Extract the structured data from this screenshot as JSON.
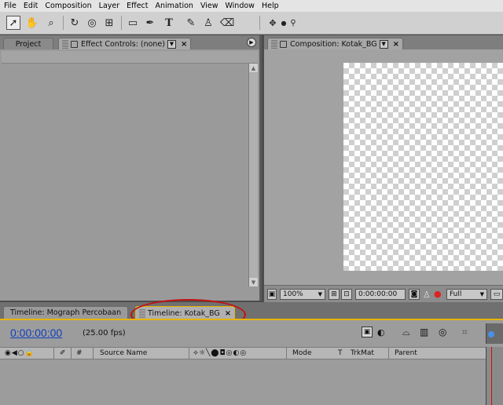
{
  "menu": [
    "File",
    "Edit",
    "Composition",
    "Layer",
    "Effect",
    "Animation",
    "View",
    "Window",
    "Help"
  ],
  "toolbar": {
    "tools": [
      {
        "name": "selection-tool-icon",
        "glyph": "➚"
      },
      {
        "name": "hand-tool-icon",
        "glyph": "✋"
      },
      {
        "name": "zoom-tool-icon",
        "glyph": "⌕"
      },
      {
        "name": "rotate-tool-icon",
        "glyph": "↻"
      },
      {
        "name": "orbit-camera-tool-icon",
        "glyph": "◎"
      },
      {
        "name": "pan-behind-tool-icon",
        "glyph": "⊞"
      },
      {
        "name": "rectangle-mask-tool-icon",
        "glyph": "▭"
      },
      {
        "name": "pen-tool-icon",
        "glyph": "✒"
      },
      {
        "name": "type-tool-icon",
        "glyph": "T"
      },
      {
        "name": "brush-tool-icon",
        "glyph": "✎"
      },
      {
        "name": "clone-stamp-tool-icon",
        "glyph": "♙"
      },
      {
        "name": "eraser-tool-icon",
        "glyph": "⌫"
      }
    ],
    "workspace_icons": [
      "✥",
      "●",
      "⚲"
    ]
  },
  "project_panel": {
    "tab_project": "Project",
    "tab_effect_controls": "Effect Controls: (none)"
  },
  "composition_panel": {
    "tab": "Composition: Kotak_BG",
    "footer": {
      "zoom": "100%",
      "timecode": "0:00:00:00",
      "resolution": "Full"
    }
  },
  "timeline": {
    "tab_inactive": "Timeline: Mograph Percobaan",
    "tab_active": "Timeline: Kotak_BG",
    "timecode": "0:00:00:00",
    "fps": "(25.00 fps)",
    "columns": {
      "hash": "#",
      "source_name": "Source Name",
      "mode": "Mode",
      "t": "T",
      "trkmat": "TrkMat",
      "parent": "Parent"
    },
    "switch_glyphs": "⟡☼╲⬤◘◎◐◎",
    "av_glyphs": "◉◀○🔒"
  },
  "colors": {
    "active_panel_border": "#e8b400",
    "timecode": "#1040c0",
    "annotation_ring": "#c21010"
  }
}
